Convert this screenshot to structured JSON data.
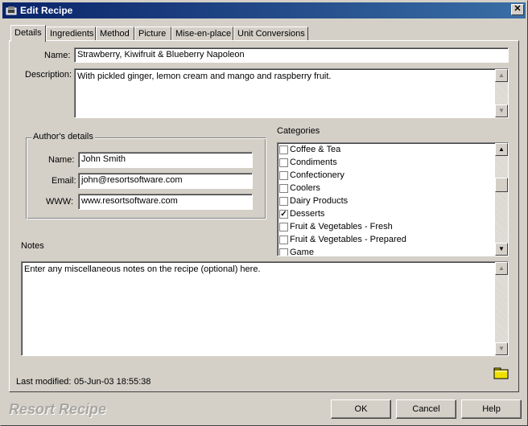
{
  "window": {
    "title": "Edit Recipe",
    "close_glyph": "✕"
  },
  "tabs": [
    {
      "label": "Details",
      "active": true
    },
    {
      "label": "Ingredients"
    },
    {
      "label": "Method"
    },
    {
      "label": "Picture"
    },
    {
      "label": "Mise-en-place"
    },
    {
      "label": "Unit Conversions"
    }
  ],
  "details": {
    "name_label": "Name:",
    "name_value": "Strawberry, Kiwifruit & Blueberry Napoleon",
    "description_label": "Description:",
    "description_value": "With pickled ginger, lemon cream and mango and raspberry fruit."
  },
  "author": {
    "group_label": "Author's details",
    "name_label": "Name:",
    "name_value": "John Smith",
    "email_label": "Email:",
    "email_value": "john@resortsoftware.com",
    "www_label": "WWW:",
    "www_value": "www.resortsoftware.com"
  },
  "categories": {
    "label": "Categories",
    "items": [
      {
        "label": "Coffee & Tea",
        "checked": false
      },
      {
        "label": "Condiments",
        "checked": false
      },
      {
        "label": "Confectionery",
        "checked": false
      },
      {
        "label": "Coolers",
        "checked": false
      },
      {
        "label": "Dairy Products",
        "checked": false
      },
      {
        "label": "Desserts",
        "checked": true
      },
      {
        "label": "Fruit & Vegetables - Fresh",
        "checked": false
      },
      {
        "label": "Fruit & Vegetables - Prepared",
        "checked": false
      },
      {
        "label": "Game",
        "checked": false
      }
    ]
  },
  "notes": {
    "label": "Notes",
    "value": "Enter any miscellaneous notes on the recipe (optional) here."
  },
  "status": {
    "last_modified_label": "Last modified:",
    "last_modified_value": "05-Jun-03 18:55:38"
  },
  "footer": {
    "brand": "Resort Recipe",
    "ok_label": "OK",
    "cancel_label": "Cancel",
    "help_label": "Help"
  },
  "icons": {
    "scroll_up": "▲",
    "scroll_down": "▼",
    "check": "✓"
  },
  "colors": {
    "titlebar_start": "#0a246a",
    "titlebar_end": "#3a6ea5",
    "face": "#d4d0c8",
    "folder": "#f0e000"
  }
}
